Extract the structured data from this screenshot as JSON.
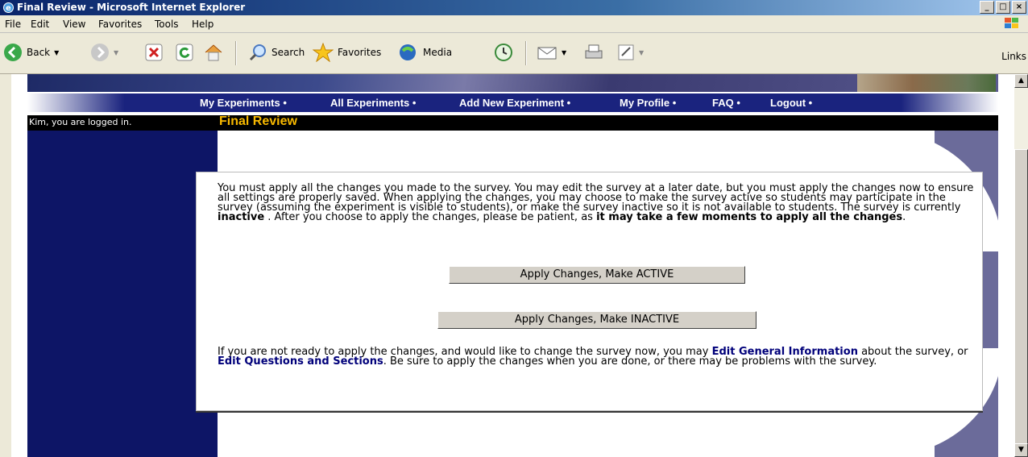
{
  "window": {
    "title": "Final Review - Microsoft Internet Explorer"
  },
  "menu": [
    "File",
    "Edit",
    "View",
    "Favorites",
    "Tools",
    "Help"
  ],
  "toolbar": {
    "back": "Back",
    "search": "Search",
    "favorites": "Favorites",
    "media": "Media",
    "links": "Links"
  },
  "nav": [
    "My Experiments •",
    "All Experiments •",
    "Add New Experiment •",
    "My Profile •",
    "FAQ •",
    "Logout •"
  ],
  "header": {
    "logged_in": "Kim, you are logged in.",
    "page_title": "Final Review"
  },
  "content": {
    "intro_1": "You must apply all the changes you made to the survey. You may edit the survey at a later date, but you must apply the changes now to ensure all settings are properly saved. When applying the changes, you may choose to make the survey active so students may participate in the survey (assuming the experiment is visible to students), or make the survey inactive so it is not available to students. The survey is currently ",
    "status": "inactive",
    "intro_2": " . After you choose to apply the changes, please be patient, as ",
    "intro_bold": "it may take a few moments to apply all the changes",
    "intro_end": ".",
    "btn_active": "Apply Changes, Make ACTIVE",
    "btn_inactive": "Apply Changes, Make INACTIVE",
    "outro_1": "If you are not ready to apply the changes, and would like to change the survey now, you may ",
    "link_general": "Edit General Information",
    "outro_2": " about the survey, or ",
    "link_questions": "Edit Questions and Sections",
    "outro_3": ". Be sure to apply the changes when you are done, or there may be problems with the survey."
  }
}
